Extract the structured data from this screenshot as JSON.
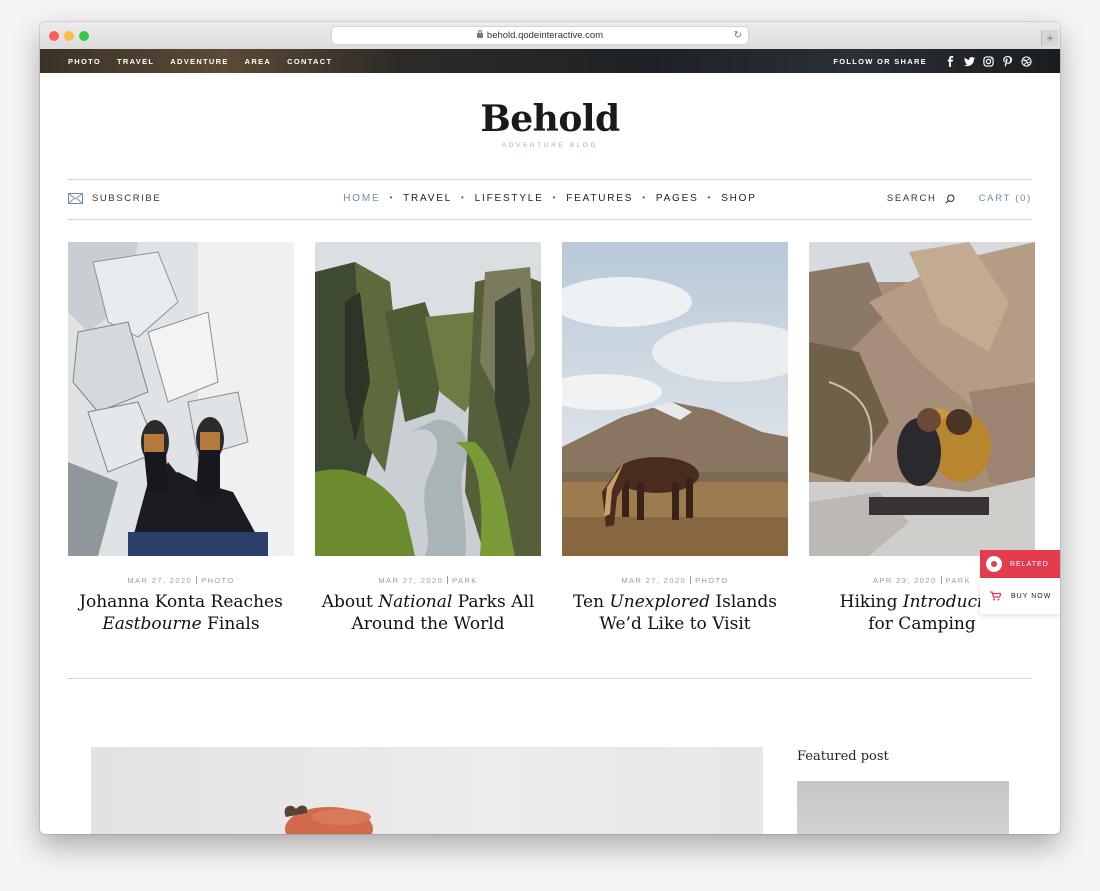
{
  "browser": {
    "url": "behold.qodeinteractive.com"
  },
  "topbar": {
    "links": [
      "PHOTO",
      "TRAVEL",
      "ADVENTURE",
      "AREA",
      "CONTACT"
    ],
    "follow_label": "FOLLOW OR SHARE",
    "social_icons": [
      "facebook-icon",
      "twitter-icon",
      "instagram-icon",
      "pinterest-icon",
      "dribbble-icon"
    ]
  },
  "logo": {
    "name": "Behold",
    "tagline": "ADVENTURE BLOG"
  },
  "nav": {
    "subscribe": "SUBSCRIBE",
    "items": [
      "HOME",
      "TRAVEL",
      "LIFESTYLE",
      "FEATURES",
      "PAGES",
      "SHOP"
    ],
    "active": "HOME",
    "search": "SEARCH",
    "cart": "CART (0)"
  },
  "posts": [
    {
      "date": "MAR 27, 2020",
      "category": "PHOTO",
      "title_plain_1": "Johanna Konta Reaches",
      "title_italic": "Eastbourne",
      "title_plain_2": "Finals"
    },
    {
      "date": "MAR 27, 2020",
      "category": "PARK",
      "title_plain_1": "About",
      "title_italic": "National",
      "title_plain_2": "Parks All Around the World"
    },
    {
      "date": "MAR 27, 2020",
      "category": "PHOTO",
      "title_plain_1": "Ten",
      "title_italic": "Unexplored",
      "title_plain_2": "Islands We’d Like to Visit"
    },
    {
      "date": "APR 23, 2020",
      "category": "PARK",
      "title_plain_1": "Hiking",
      "title_italic": "Introducing",
      "title_plain_2": "for Camping"
    }
  ],
  "floating": {
    "related": "RELATED",
    "buy_now": "BUY NOW"
  },
  "sidebar": {
    "featured_label": "Featured post"
  },
  "colors": {
    "accent_blue": "#6b8fa8",
    "related_red": "#e23c4e",
    "meta_blue": "#8aa4b4"
  }
}
